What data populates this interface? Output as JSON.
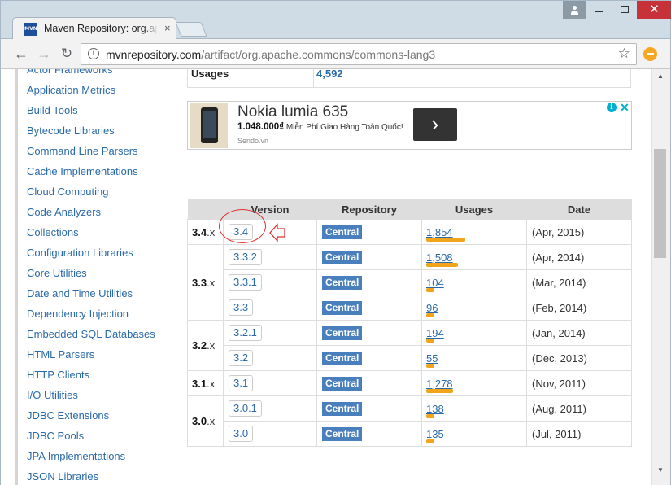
{
  "browser": {
    "tab_title": "Maven Repository: org.apache.commons",
    "favicon_text": "MVN",
    "tab_close": "×",
    "url_host": "mvnrepository.com",
    "url_path": "/artifact/org.apache.commons/commons-lang3",
    "page_info_icon": "i",
    "bookmark_star": "☆",
    "window_close": "✕"
  },
  "sidebar": {
    "items": [
      "Actor Frameworks",
      "Application Metrics",
      "Build Tools",
      "Bytecode Libraries",
      "Command Line Parsers",
      "Cache Implementations",
      "Cloud Computing",
      "Code Analyzers",
      "Collections",
      "Configuration Libraries",
      "Core Utilities",
      "Date and Time Utilities",
      "Dependency Injection",
      "Embedded SQL Databases",
      "HTML Parsers",
      "HTTP Clients",
      "I/O Utilities",
      "JDBC Extensions",
      "JDBC Pools",
      "JPA Implementations",
      "JSON Libraries"
    ]
  },
  "summary": {
    "usages_label": "Usages",
    "usages_value": "4,592"
  },
  "ad": {
    "title": "Nokia lumia 635",
    "price": "1.048.000₫",
    "price_note": " Miễn Phí Giao Hàng Toàn Quốc!",
    "source": "Sendo.vn",
    "button_icon": "chevron-right-icon",
    "info_glyph": "i",
    "close_glyph": "✕"
  },
  "versions_table": {
    "headers": [
      "Version",
      "Repository",
      "Usages",
      "Date"
    ],
    "rows": [
      {
        "group": "3.4",
        "version": "3.4",
        "repository": "Central",
        "usages": "1,854",
        "usage_fraction": 1.0,
        "date": "(Apr, 2015)"
      },
      {
        "group": "3.3",
        "version": "3.3.2",
        "repository": "Central",
        "usages": "1,508",
        "usage_fraction": 0.81,
        "date": "(Apr, 2014)"
      },
      {
        "group": "",
        "version": "3.3.1",
        "repository": "Central",
        "usages": "104",
        "usage_fraction": 0.06,
        "date": "(Mar, 2014)"
      },
      {
        "group": "",
        "version": "3.3",
        "repository": "Central",
        "usages": "96",
        "usage_fraction": 0.05,
        "date": "(Feb, 2014)"
      },
      {
        "group": "3.2",
        "version": "3.2.1",
        "repository": "Central",
        "usages": "194",
        "usage_fraction": 0.1,
        "date": "(Jan, 2014)"
      },
      {
        "group": "",
        "version": "3.2",
        "repository": "Central",
        "usages": "55",
        "usage_fraction": 0.03,
        "date": "(Dec, 2013)"
      },
      {
        "group": "3.1",
        "version": "3.1",
        "repository": "Central",
        "usages": "1,278",
        "usage_fraction": 0.69,
        "date": "(Nov, 2011)"
      },
      {
        "group": "3.0",
        "version": "3.0.1",
        "repository": "Central",
        "usages": "138",
        "usage_fraction": 0.07,
        "date": "(Aug, 2011)"
      },
      {
        "group": "",
        "version": "3.0",
        "repository": "Central",
        "usages": "135",
        "usage_fraction": 0.07,
        "date": "(Jul, 2011)"
      }
    ],
    "group_suffix": ".x"
  },
  "colors": {
    "link": "#2a6aa8",
    "badge": "#4a7fbd",
    "usage_bar": "#f2a41d",
    "annotation": "#e03030"
  }
}
